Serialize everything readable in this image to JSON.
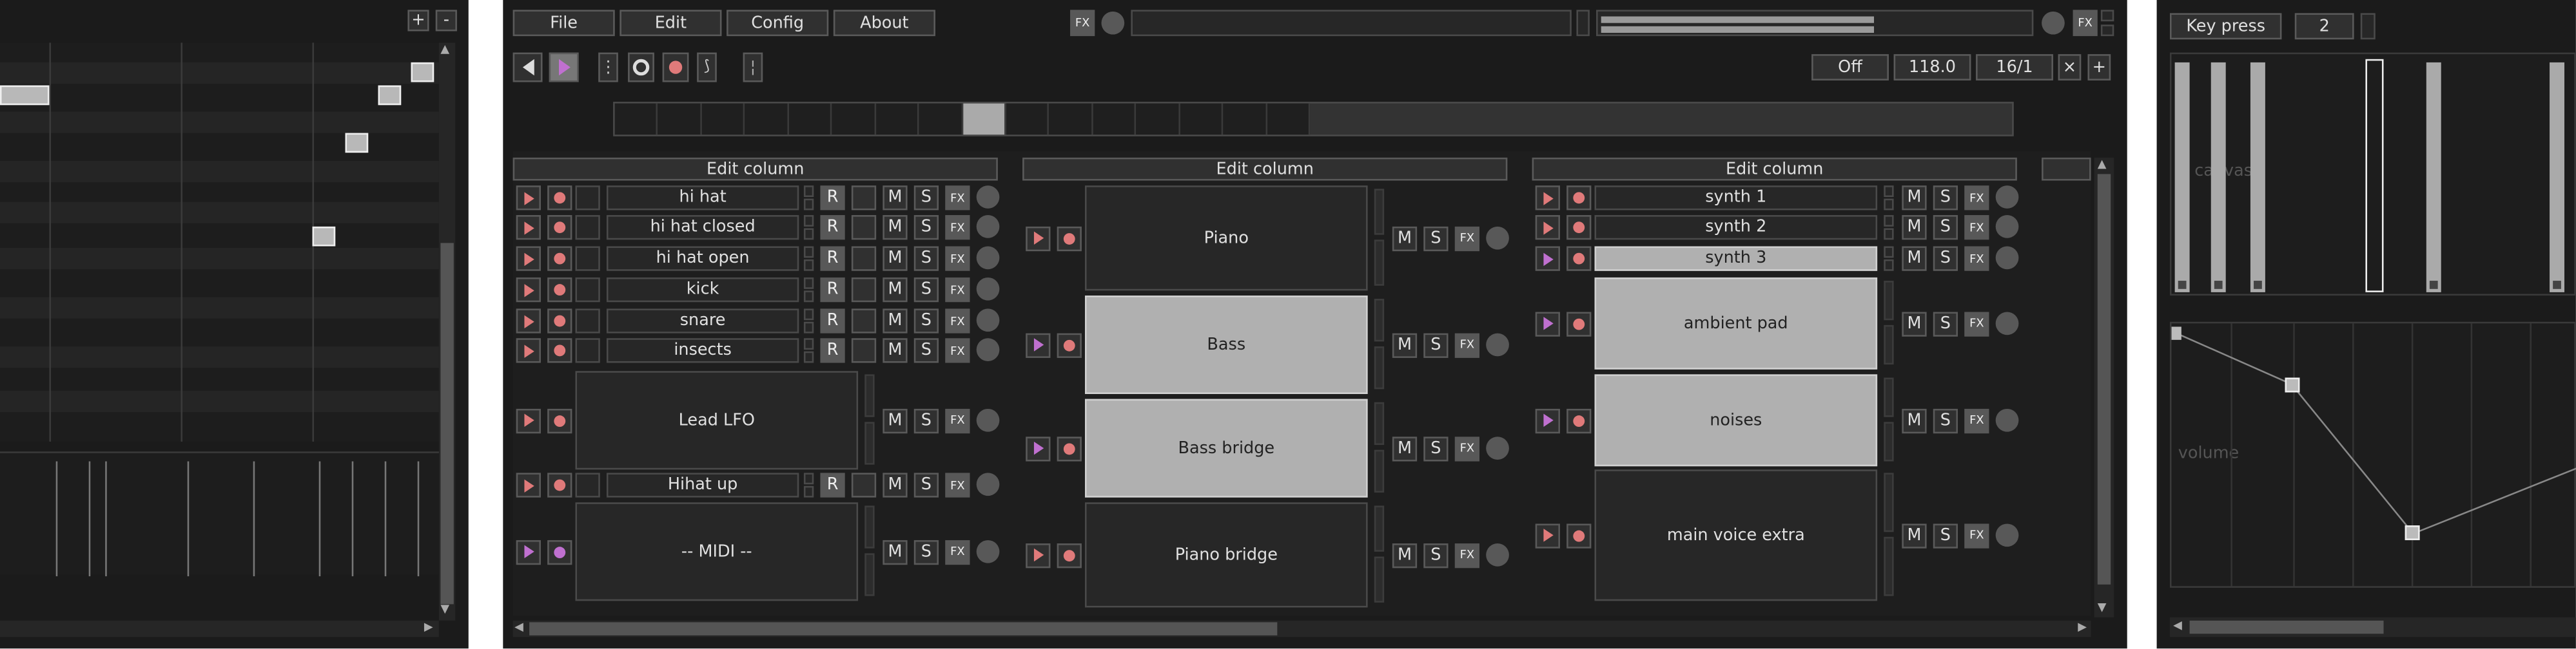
{
  "colors": {
    "bg": "#1b1b1b",
    "accent_play": "#e07a7a",
    "accent_purple": "#c070d0",
    "highlight": "#a8a8a8"
  },
  "piano_roll": {
    "zoom_in": "+",
    "zoom_out": "-"
  },
  "menu": {
    "file": "File",
    "edit": "Edit",
    "config": "Config",
    "about": "About"
  },
  "header": {
    "fx": "FX",
    "loop_mode": "Off",
    "tempo": "118.0",
    "grid": "16/1",
    "close": "×",
    "add": "+"
  },
  "transport": {
    "play": "play-icon"
  },
  "columns": [
    {
      "edit_label": "Edit column",
      "tracks": [
        {
          "name": "hi hat",
          "rec": "R",
          "mute": "M",
          "solo": "S",
          "fx": "FX"
        },
        {
          "name": "hi hat closed",
          "rec": "R",
          "mute": "M",
          "solo": "S",
          "fx": "FX"
        },
        {
          "name": "hi hat open",
          "rec": "R",
          "mute": "M",
          "solo": "S",
          "fx": "FX"
        },
        {
          "name": "kick",
          "rec": "R",
          "mute": "M",
          "solo": "S",
          "fx": "FX"
        },
        {
          "name": "snare",
          "rec": "R",
          "mute": "M",
          "solo": "S",
          "fx": "FX"
        },
        {
          "name": "insects",
          "rec": "R",
          "mute": "M",
          "solo": "S",
          "fx": "FX"
        },
        {
          "name": "Lead LFO",
          "mute": "M",
          "solo": "S",
          "fx": "FX"
        },
        {
          "name": "Hihat up",
          "rec": "R",
          "mute": "M",
          "solo": "S",
          "fx": "FX"
        },
        {
          "name": "-- MIDI --",
          "mute": "M",
          "solo": "S",
          "fx": "FX"
        }
      ]
    },
    {
      "edit_label": "Edit column",
      "tracks": [
        {
          "name": "Piano",
          "mute": "M",
          "solo": "S",
          "fx": "FX"
        },
        {
          "name": "Bass",
          "mute": "M",
          "solo": "S",
          "fx": "FX"
        },
        {
          "name": "Bass bridge",
          "mute": "M",
          "solo": "S",
          "fx": "FX"
        },
        {
          "name": "Piano bridge",
          "mute": "M",
          "solo": "S",
          "fx": "FX"
        }
      ]
    },
    {
      "edit_label": "Edit column",
      "tracks": [
        {
          "name": "synth 1",
          "mute": "M",
          "solo": "S",
          "fx": "FX"
        },
        {
          "name": "synth 2",
          "mute": "M",
          "solo": "S",
          "fx": "FX"
        },
        {
          "name": "synth 3",
          "mute": "M",
          "solo": "S",
          "fx": "FX"
        },
        {
          "name": "ambient pad",
          "mute": "M",
          "solo": "S",
          "fx": "FX"
        },
        {
          "name": "noises",
          "mute": "M",
          "solo": "S",
          "fx": "FX"
        },
        {
          "name": "main voice extra",
          "mute": "M",
          "solo": "S",
          "fx": "FX"
        }
      ]
    }
  ],
  "action_editor": {
    "mode": "Key press",
    "value": "2",
    "canvas_label": "canvas",
    "envelope_label": "volume"
  }
}
